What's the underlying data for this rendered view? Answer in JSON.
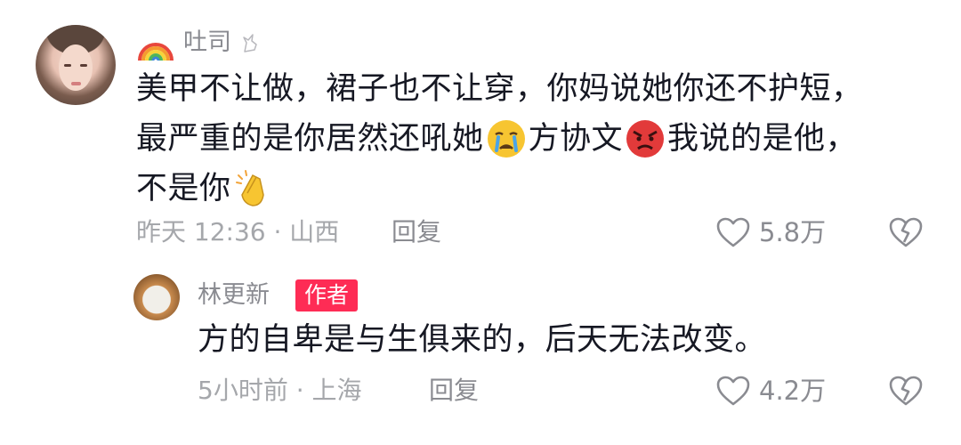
{
  "main_comment": {
    "username": "吐司",
    "lines": [
      [
        "美甲不让做，裙子也不让穿，你妈说她你还不护短，"
      ],
      [
        "最严重的是你居然还吼她",
        {
          "emoji": "crying-face"
        },
        "方协文",
        {
          "emoji": "angry-face"
        },
        "我说的是他，"
      ],
      [
        "不是你",
        {
          "emoji": "clapping-hands"
        }
      ]
    ],
    "meta": "昨天 12:36 · 山西",
    "reply_label": "回复",
    "like_count": "5.8万"
  },
  "reply_comment": {
    "username": "林更新",
    "badge": "作者",
    "text": "方的自卑是与生俱来的，后天无法改变。",
    "meta": "5小时前 · 上海",
    "reply_label": "回复",
    "like_count": "4.2万"
  },
  "colors": {
    "accent": "#fe2c55",
    "secondary_text": "#8a8b91",
    "meta_text": "#a5a7ab",
    "primary_text": "#161823"
  }
}
